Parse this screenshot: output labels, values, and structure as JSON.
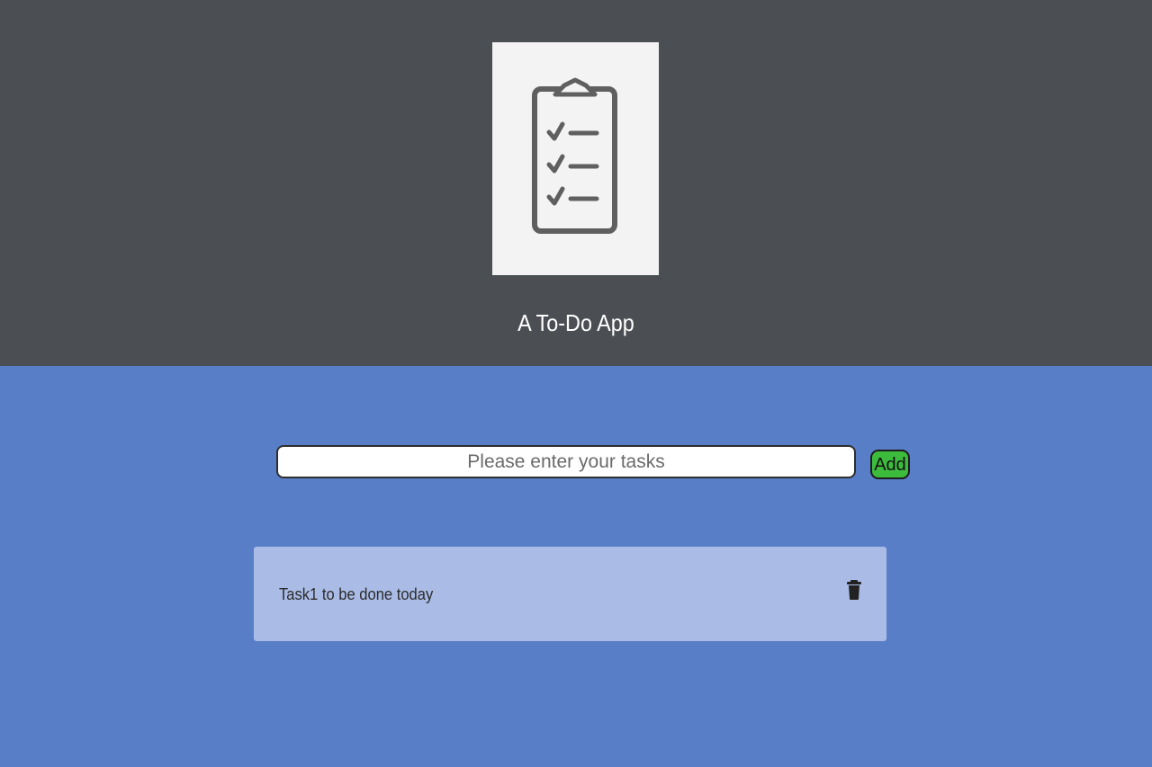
{
  "header": {
    "logo_icon": "clipboard-checklist-icon",
    "title": "A To-Do App",
    "background_color": "#4b4e53"
  },
  "main": {
    "background_color": "#597ec8",
    "input": {
      "placeholder": "Please enter your tasks",
      "value": ""
    },
    "add_button_label": "Add",
    "add_button_color": "#3dbb3d",
    "tasks": [
      {
        "text": "Task1 to be done today",
        "delete_icon": "trash-icon"
      }
    ]
  }
}
